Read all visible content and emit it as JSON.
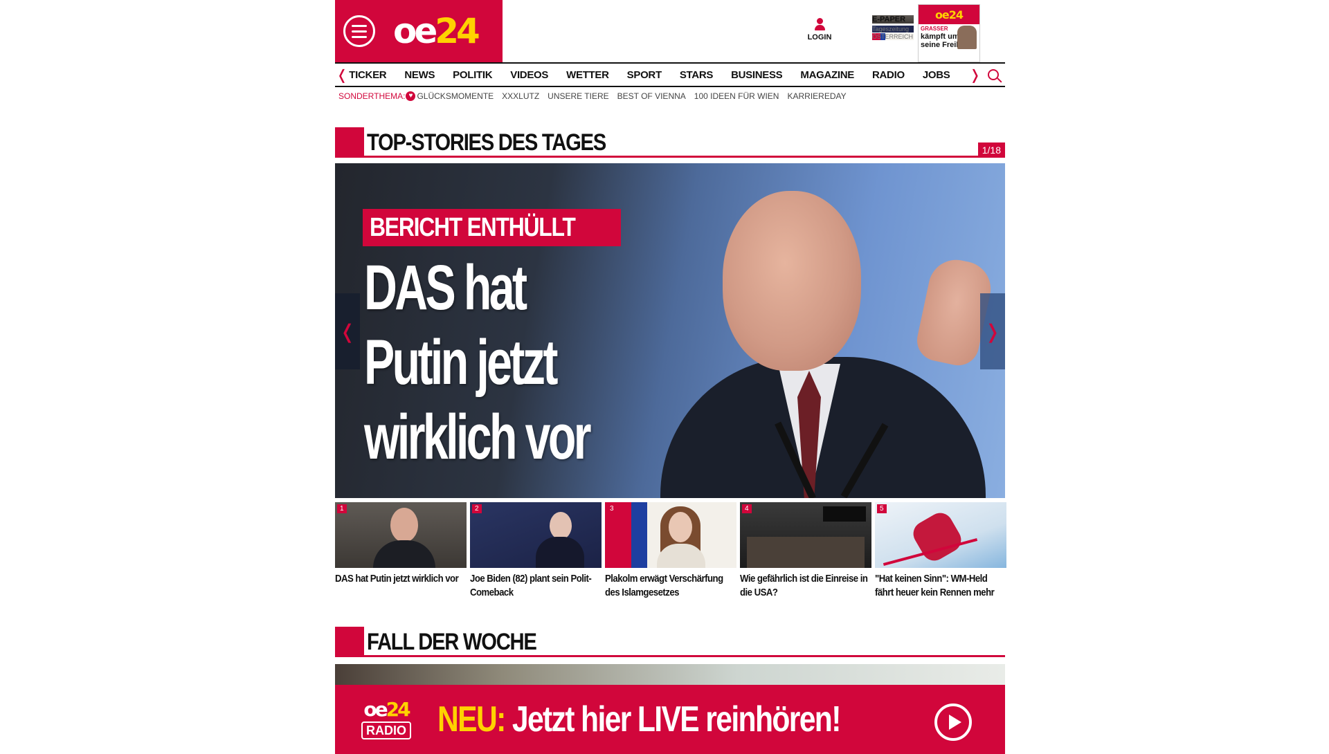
{
  "header": {
    "logo_oe": "oe",
    "logo_num": "24",
    "login_label": "LOGIN",
    "epaper": {
      "title": "E-PAPER",
      "subtitle": "Tageszeitung",
      "region": "ÖSTERREICH",
      "cover_logo": "oe24",
      "cover_kicker": "GRASSER",
      "cover_headline": "kämpft um seine Freiheit"
    }
  },
  "nav": {
    "prev_arrow": "❬",
    "next_arrow": "❭",
    "items": [
      "TICKER",
      "NEWS",
      "POLITIK",
      "VIDEOS",
      "WETTER",
      "SPORT",
      "STARS",
      "BUSINESS",
      "MAGAZINE",
      "RADIO",
      "JOBS"
    ]
  },
  "subnav": {
    "label": "SONDERTHEMA:",
    "items": [
      "GLÜCKSMOMENTE",
      "XXXLUTZ",
      "UNSERE TIERE",
      "BEST OF VIENNA",
      "100 IDEEN FÜR WIEN",
      "KARRIEREDAY"
    ]
  },
  "top_stories": {
    "title": "TOP-STORIES DES TAGES",
    "counter": "1/18",
    "hero": {
      "kicker": "BERICHT ENTHÜLLT",
      "headline_lines": [
        "DAS hat",
        "Putin jetzt",
        "wirklich vor"
      ],
      "prev_arrow": "❬",
      "next_arrow": "❭"
    },
    "thumbs": [
      {
        "num": "1",
        "caption": "DAS hat Putin jetzt wirklich vor"
      },
      {
        "num": "2",
        "caption": "Joe Biden (82) plant sein Polit-Comeback"
      },
      {
        "num": "3",
        "caption": "Plakolm erwägt Verschärfung des Islamgesetzes"
      },
      {
        "num": "4",
        "caption": "Wie gefährlich ist die Einreise in die USA?"
      },
      {
        "num": "5",
        "caption": "\"Hat keinen Sinn\": WM-Held fährt heuer kein Rennen mehr"
      }
    ]
  },
  "fall_der_woche": {
    "title": "FALL DER WOCHE"
  },
  "radio_banner": {
    "logo_oe": "oe",
    "logo_num": "24",
    "logo_radio": "RADIO",
    "new_label": "NEU:",
    "text": "Jetzt hier LIVE reinhören!"
  },
  "colors": {
    "brand_red": "#d1063b",
    "brand_yellow": "#ffd200"
  }
}
